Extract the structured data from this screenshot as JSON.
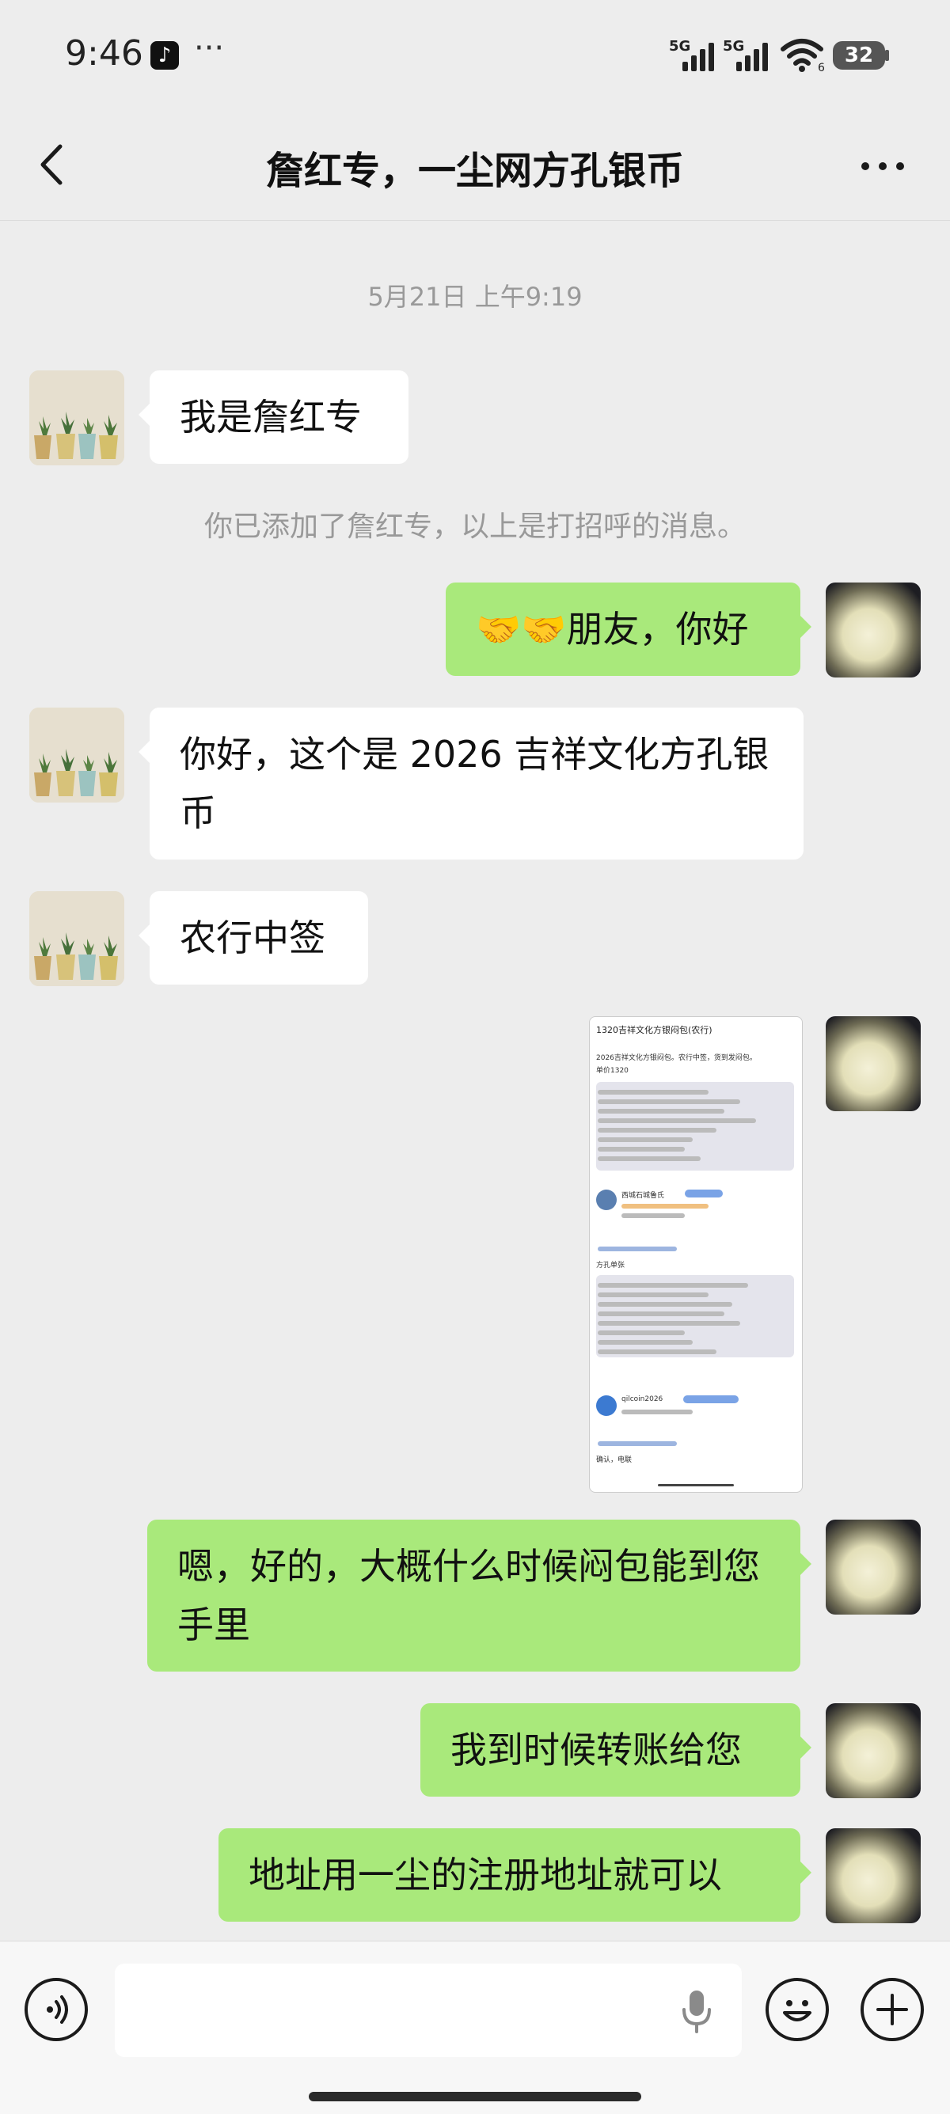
{
  "status": {
    "time": "9:46",
    "tiktok": "♪",
    "dots": "···",
    "net1": "5G",
    "net2": "5G",
    "wifi_sub": "6",
    "battery": "32"
  },
  "header": {
    "title": "詹红专，一尘网方孔银币"
  },
  "timestamp": "5月21日 上午9:19",
  "system_msg": "你已添加了詹红专，以上是打招呼的消息。",
  "messages": [
    {
      "side": "left",
      "text": "我是詹红专"
    },
    {
      "side": "right",
      "text": "🤝🤝朋友，你好"
    },
    {
      "side": "left",
      "text": "你好，这个是 2026 吉祥文化方孔银币"
    },
    {
      "side": "left",
      "text": "农行中签"
    },
    {
      "side": "right",
      "text": "嗯，好的，大概什么时候闷包能到您手里"
    },
    {
      "side": "right",
      "text": "我到时候转账给您"
    },
    {
      "side": "right",
      "text": "地址用一尘的注册地址就可以"
    }
  ],
  "image_message": {
    "title": "1320吉祥文化方银闷包(农行)",
    "line1": "2026吉祥文化方银闷包。农行中签，货到发闷包。",
    "line2": "单价1320",
    "user1": "西城石城鲁氏",
    "section": "方孔单张",
    "user2": "qilcoin2026",
    "footer": "确认，电联"
  },
  "input": {
    "placeholder": ""
  },
  "icons": {
    "back": "back-chevron-icon",
    "more": "more-dots-icon",
    "voice": "voice-icon",
    "mic": "mic-icon",
    "emoji": "emoji-icon",
    "add": "add-icon"
  }
}
